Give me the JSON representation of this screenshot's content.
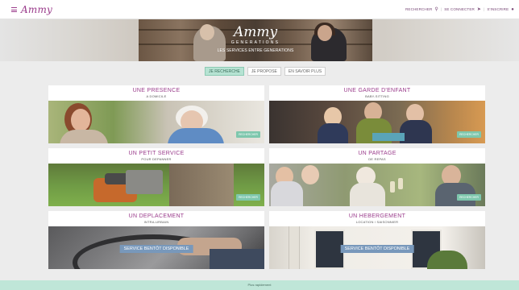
{
  "header": {
    "logo": "Ammy",
    "nav": {
      "search_label": "RECHERCHER",
      "login_label": "SE CONNECTER",
      "register_label": "S'INSCRIRE"
    }
  },
  "hero": {
    "title": "Ammy",
    "subtitle": "GENERATIONS",
    "tagline": "LES SERVICES ENTRE GENERATIONS"
  },
  "tabs": [
    {
      "label": "JE RECHERCHE",
      "active": true
    },
    {
      "label": "JE PROPOSE",
      "active": false
    },
    {
      "label": "EN SAVOIR PLUS",
      "active": false
    }
  ],
  "cards": [
    {
      "title": "UNE PRESENCE",
      "subtitle": "A DOMICILE",
      "button": "RECHERCHER"
    },
    {
      "title": "UNE GARDE D'ENFANT",
      "subtitle": "BABY-SITTING",
      "button": "RECHERCHER"
    },
    {
      "title": "UN PETIT SERVICE",
      "subtitle": "POUR DEPANNER",
      "button": "RECHERCHER"
    },
    {
      "title": "UN PARTAGE",
      "subtitle": "DE REPAS",
      "button": "RECHERCHER"
    },
    {
      "title": "UN DEPLACEMENT",
      "subtitle": "INTRA-URBAIN",
      "button": "SERVICE BENTÔT DISPONIBLE"
    },
    {
      "title": "UN HEBERGEMENT",
      "subtitle": "LOCATION / SAISONNIER",
      "button": "SERVICE BENTÔT DISPONIBLE"
    }
  ],
  "footer": {
    "text": "Plus rapidement"
  },
  "colors": {
    "brand": "#9a3b8b",
    "accent": "#7ec7ad",
    "tab_active": "#b6e3d3",
    "soon_button": "#7898bb",
    "footer": "#bfe6d8"
  }
}
